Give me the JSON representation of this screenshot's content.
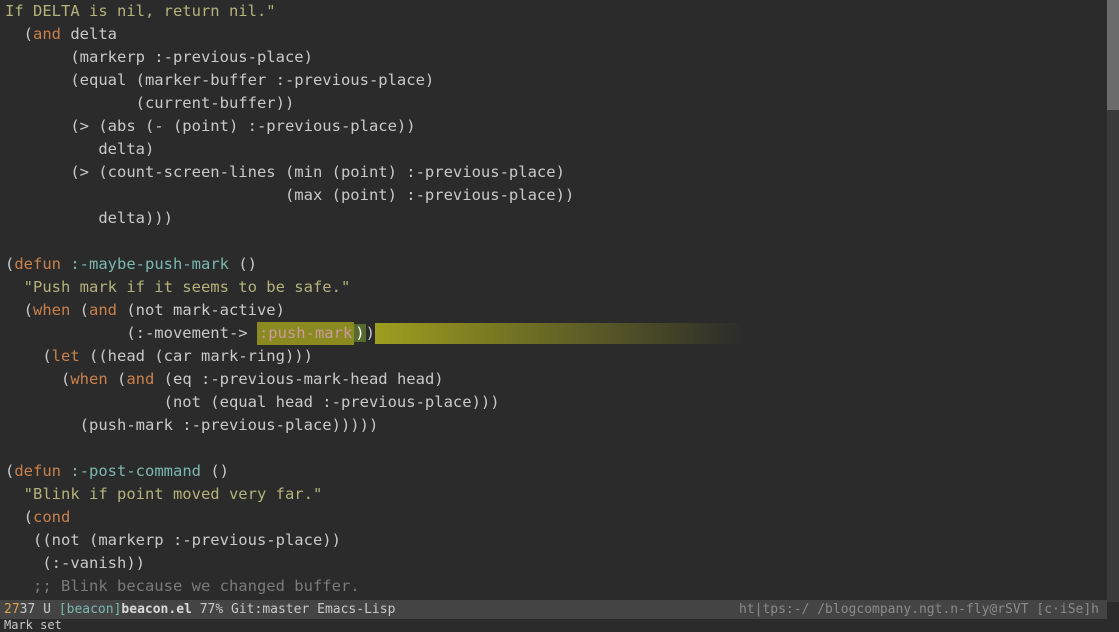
{
  "code": {
    "l1a": "If DELTA is nil, return nil.\"",
    "l2_and": "and",
    "l2_delta": " delta",
    "l3": "       (markerp :-previous-place)",
    "l4": "       (equal (marker-buffer :-previous-place)",
    "l5": "              (current-buffer))",
    "l6": "       (> (abs (- (point) :-previous-place))",
    "l7": "          delta)",
    "l8": "       (> (count-screen-lines (min (point) :-previous-place)",
    "l9": "                              (max (point) :-previous-place))",
    "l10": "          delta)))",
    "defun1": "defun",
    "fname1": " :-maybe-push-mark",
    "rest1": " ()",
    "doc1": "  \"Push mark if it seems to be safe.\"",
    "when1": "when",
    "and1": "and",
    "l14b": " (not mark-active)",
    "l15a": "             (:-movement-> ",
    "pushkw": ":push-mark",
    "l15c": ")",
    "l15d": ")",
    "let1": "let",
    "l16b": " ((head (car mark-ring)))",
    "when2": "when",
    "and2": "and",
    "l17b": " (eq :-previous-mark-head head)",
    "l18": "                 (not (equal head :-previous-place)))",
    "l19": "        (push-mark :-previous-place)))))",
    "defun2": "defun",
    "fname2": " :-post-command",
    "rest2": " ()",
    "doc2": "  \"Blink if point moved very far.\"",
    "cond": "cond",
    "l23": "   ((not (markerp :-previous-place))",
    "l24": "    (:-vanish))",
    "comment1": "   ;; Blink because we changed buffer."
  },
  "modeline": {
    "pos": "27",
    "pos2": "37",
    "u": " U ",
    "proj": "[beacon]",
    "file": "beacon.el",
    "pct": "77%",
    "git": "Git:master",
    "mode": "Emacs-Lisp",
    "right": "ht|tps:-/ /blogcompany.ngt.n-fly@rSVT [c·iSe]h"
  },
  "minibuf": "Mark set"
}
